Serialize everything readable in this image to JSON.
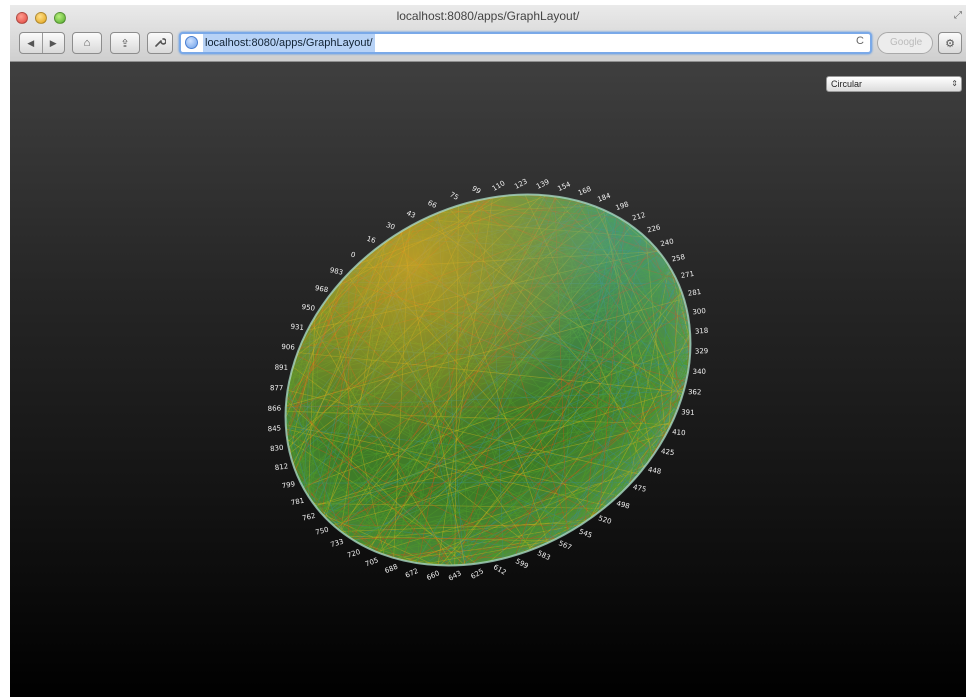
{
  "window": {
    "title": "localhost:8080/apps/GraphLayout/"
  },
  "toolbar": {
    "back_glyph": "◀",
    "forward_glyph": "▶",
    "home_glyph": "⌂",
    "share_glyph": "⇪",
    "tools_glyph": "🔧",
    "url": "localhost:8080/apps/GraphLayout/",
    "reload_glyph": "C",
    "search_placeholder": "Google",
    "settings_glyph": "⚙"
  },
  "layout_selector": {
    "selected": "Circular"
  },
  "graph": {
    "node_labels": [
      "931",
      "950",
      "968",
      "983",
      "0",
      "16",
      "30",
      "43",
      "66",
      "75",
      "99",
      "110",
      "123",
      "139",
      "154",
      "168",
      "184",
      "198",
      "212",
      "226",
      "240",
      "258",
      "271",
      "281",
      "300",
      "318",
      "329",
      "340",
      "362",
      "391",
      "410",
      "425",
      "448",
      "475",
      "498",
      "520",
      "545",
      "567",
      "583",
      "599",
      "612",
      "625",
      "643",
      "660",
      "672",
      "688",
      "705",
      "720",
      "733",
      "750",
      "762",
      "781",
      "799",
      "812",
      "830",
      "845",
      "866",
      "877",
      "891",
      "906"
    ],
    "colors": {
      "edge_green": "#4f9a2a",
      "edge_yellow": "#c9b21c",
      "edge_orange": "#c7561a",
      "edge_teal": "#3b8f86",
      "disc_base": "#2c6a22"
    }
  }
}
